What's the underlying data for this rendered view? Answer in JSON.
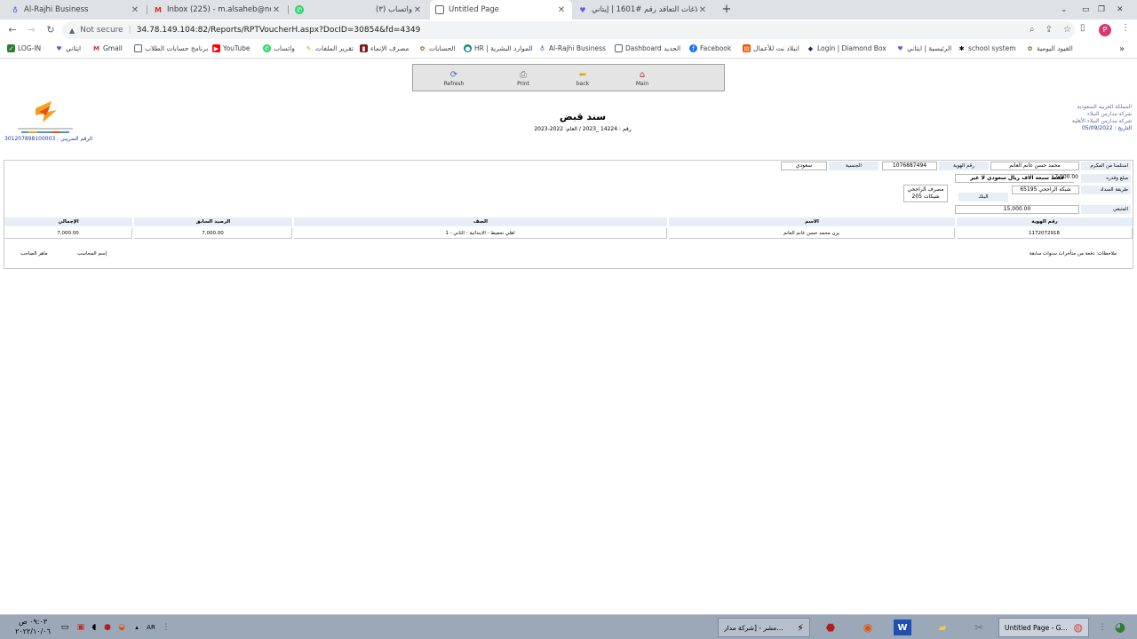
{
  "tabs": [
    {
      "title": "Al-Rajhi Business",
      "icon": "alrajhi-icon",
      "color": "#3b4bbd"
    },
    {
      "title": "Inbox (225) - m.alsaheb@nobala.",
      "icon": "gmail-icon",
      "color": "#d93025"
    },
    {
      "title": "(٣) واتساب",
      "icon": "whatsapp-icon",
      "color": "#25d366"
    },
    {
      "title": "Untitled Page",
      "icon": "page-icon",
      "color": "#5f6368"
    },
    {
      "title": "بلاغات التعاقد رقم #1601 | إيتاني",
      "icon": "etani-icon",
      "color": "#6e5bd6"
    }
  ],
  "new_tab": "+",
  "address": {
    "security": "Not secure",
    "url": "34.78.149.104:82/Reports/RPTVoucherH.aspx?DocID=30854&fd=4349"
  },
  "profile_initial": "P",
  "bookmarks": [
    {
      "label": "LOG-IN",
      "icon": "log-in-icon",
      "color": "#2e7d32"
    },
    {
      "label": "ايتاني",
      "icon": "etani-icon",
      "color": "#6e5bd6"
    },
    {
      "label": "Gmail",
      "icon": "gmail-icon",
      "color": "#d93025"
    },
    {
      "label": "برنامج حسابات الطلاب",
      "icon": "doc-icon",
      "color": "#5f6368"
    },
    {
      "label": "YouTube",
      "icon": "youtube-icon",
      "color": "#ff0000"
    },
    {
      "label": "واتساب",
      "icon": "whatsapp-icon",
      "color": "#25d366"
    },
    {
      "label": "تقرير الملفات",
      "icon": "note-icon",
      "color": "#c2b200"
    },
    {
      "label": "مصرف الإنماء",
      "icon": "bank-icon",
      "color": "#7a1a1a"
    },
    {
      "label": "الحسابات",
      "icon": "accounts-icon",
      "color": "#8a6d3b"
    },
    {
      "label": "HR | الموارد البشرية",
      "icon": "hr-icon",
      "color": "#00897b"
    },
    {
      "label": "Al-Rajhi Business",
      "icon": "alrajhi-icon",
      "color": "#3b4bbd"
    },
    {
      "label": "Dashboard الجديد",
      "icon": "dashboard-icon",
      "color": "#5f6368"
    },
    {
      "label": "Facebook",
      "icon": "facebook-icon",
      "color": "#1877f2"
    },
    {
      "label": "انبلاد نت للأعمال",
      "icon": "albilad-icon",
      "color": "#e65100"
    },
    {
      "label": "Login | Diamond Box",
      "icon": "diamond-box-icon",
      "color": "#1a237e"
    },
    {
      "label": "الرئيسية | ايتاني",
      "icon": "etani-icon",
      "color": "#6e5bd6"
    },
    {
      "label": "school system",
      "icon": "school-icon",
      "color": "#000000"
    },
    {
      "label": "القيود اليومية",
      "icon": "journal-icon",
      "color": "#8a6d3b"
    }
  ],
  "bookmarks_more": "»",
  "report_toolbar": {
    "refresh": "Refresh",
    "print": "Print",
    "back": "back",
    "main": "Main"
  },
  "report": {
    "title": "سند قبض",
    "number_line": "رقم : 14224 _2023 / العام: 2022-2023",
    "org_line1": "المملكة العربية السعودية",
    "org_line2": "شركة مدارس النبلاء",
    "org_line3": "شركة مدارس النبلاء الأهلية",
    "date": "التاريخ : 05/09/2022",
    "tax_number": "الرقم الضريبي : 301207898100003"
  },
  "receipt": {
    "received_from_label": "استلمنا من المكرم",
    "received_from_value": "محمد حسن غانم العانم",
    "id_label": "رقم الهوية",
    "id_value": "1076887494",
    "nationality_label": "الجنسية",
    "nationality_value": "سعودي",
    "amount_label": "مبلغ وقدره",
    "amount_value": "7,000.00",
    "amount_words": "فقط سبعة آلاف ريال سعودي لا غير",
    "payment_method_label": "طريقة السداد",
    "payment_method_value": "شبكة الراجحي 65195",
    "bank_label": "البنك",
    "bank_value_line1": "مصرف الراجحي",
    "bank_value_line2": "شبكات 205",
    "remaining_label": "المتبقي",
    "remaining_value": "15,000.00",
    "columns": [
      "رقم الهوية",
      "الاسم",
      "الصف",
      "الرصيد السابق",
      "الإجمالي"
    ],
    "rows": [
      [
        "1172072918",
        "يزن محمد حسن غانم العانم",
        "اهلي تحفيظ - الابتدائية - الثاني - 1",
        "7,000.00",
        "7,000.00"
      ]
    ],
    "notes": "ملاحظات: دفعة من متأخرات سنوات سابقة",
    "accountant_label": "إسم المحاسب",
    "signature_label": "ماهر الصاحب"
  },
  "taskbar": {
    "clock_time": "٠٩:٠٣ ص",
    "clock_date": "٢٠٢٢/١٠/٠٦",
    "lang": "AR",
    "tasks": [
      {
        "label": "مشر - [شركة مدار...",
        "icon": "app-window-icon"
      },
      {
        "label": "Untitled Page - G...",
        "icon": "chrome-icon"
      }
    ]
  }
}
